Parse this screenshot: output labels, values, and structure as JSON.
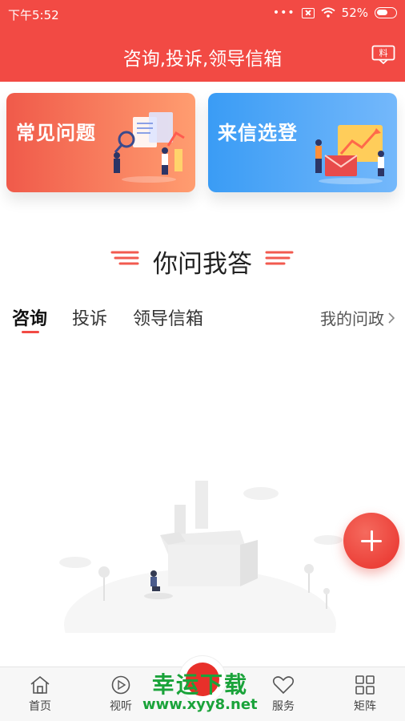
{
  "status_bar": {
    "time": "下午5:52",
    "battery": "52%"
  },
  "header": {
    "title": "咨询,投诉,领导信箱"
  },
  "cards": [
    {
      "label": "常见问题",
      "icon": "faq-illustration"
    },
    {
      "label": "来信选登",
      "icon": "letters-illustration"
    }
  ],
  "section": {
    "title": "你问我答"
  },
  "tabs": [
    {
      "label": "咨询"
    },
    {
      "label": "投诉"
    },
    {
      "label": "领导信箱"
    }
  ],
  "my_link": {
    "label": "我的问政"
  },
  "bottom_nav": [
    {
      "label": "首页",
      "icon": "home-icon"
    },
    {
      "label": "视听",
      "icon": "play-icon"
    },
    {
      "label": "",
      "icon": "center-logo-icon"
    },
    {
      "label": "服务",
      "icon": "heart-icon"
    },
    {
      "label": "矩阵",
      "icon": "grid-icon"
    }
  ],
  "watermark": {
    "main": "幸运下载",
    "url": "www.xyy8.net"
  },
  "colors": {
    "brand_red": "#f24a44",
    "card_orange": "#f05a4a",
    "card_blue": "#3a9cf5"
  }
}
